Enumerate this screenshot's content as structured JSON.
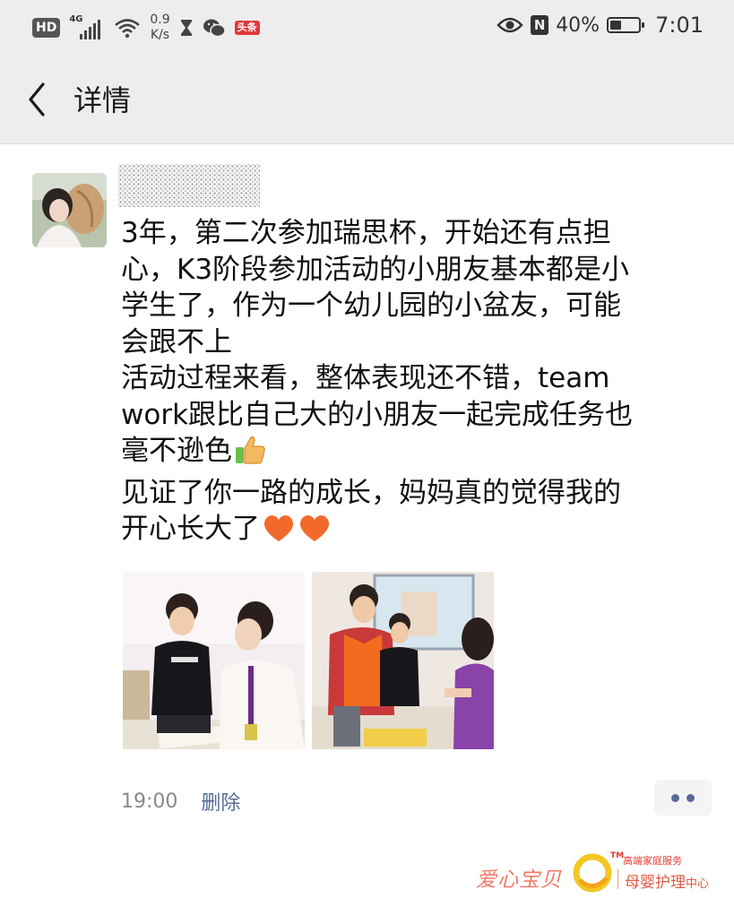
{
  "status_bar": {
    "hd": "HD",
    "network_type": "4G",
    "net_speed_value": "0.9",
    "net_speed_unit": "K/s",
    "notif_badge": "头条",
    "battery_percent": "40%",
    "battery_level": 0.4,
    "nfc": "N",
    "time": "7:01"
  },
  "nav": {
    "title": "详情"
  },
  "post": {
    "username": "",
    "lines": [
      "3年，第二次参加瑞思杯，开始还有点担",
      "心，K3阶段参加活动的小朋友基本都是小",
      "学生了，作为一个幼儿园的小盆友，可能",
      "会跟不上",
      "活动过程来看，整体表现还不错，team",
      "work跟比自己大的小朋友一起完成任务也",
      "毫不逊色",
      "见证了你一路的成长，妈妈真的觉得我的",
      "开心长大了"
    ],
    "emojis": {
      "line7": "thumbs-up",
      "line9": [
        "orange-heart",
        "orange-heart"
      ]
    },
    "time": "19:00",
    "delete_label": "删除"
  },
  "watermark": {
    "name": "爱心宝贝",
    "tm": "TM",
    "tagline": "高端家庭服务",
    "center_main": "母婴护理",
    "center_small": "中心"
  },
  "colors": {
    "header_bg": "#ededed",
    "link_blue": "#576b95",
    "meta_gray": "#8a8a8a",
    "watermark_red": "#e53a2e"
  }
}
